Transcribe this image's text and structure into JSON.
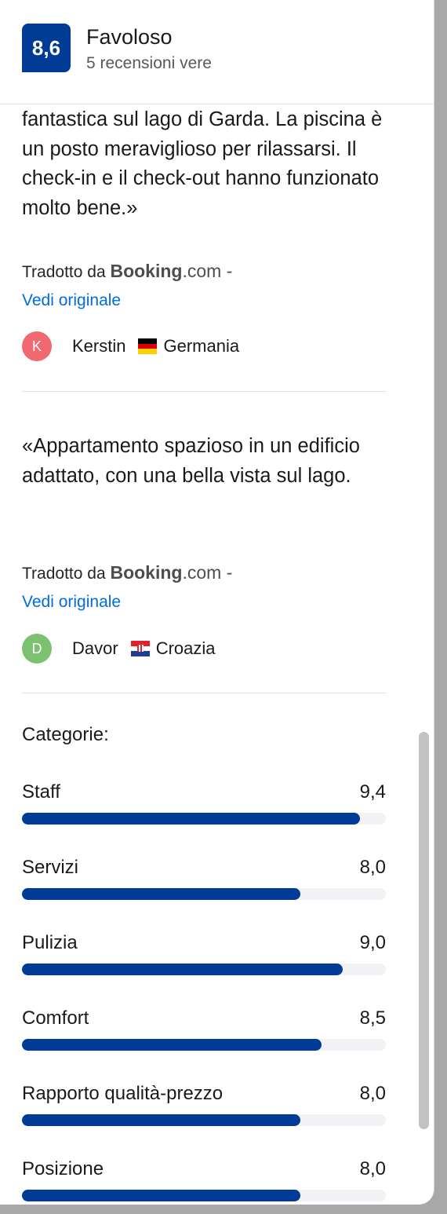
{
  "header": {
    "score": "8,6",
    "rating_label": "Favoloso",
    "review_count": "5 recensioni vere"
  },
  "colors": {
    "brand_blue": "#003b95",
    "link_blue": "#006ce4"
  },
  "reviews": [
    {
      "text": "fantastica sul lago di Garda. La piscina è un posto meraviglioso per rilassarsi. Il check-in e il check-out hanno funzionato molto bene.»",
      "translated_prefix": "Tradotto da",
      "brand_bold": "Booking",
      "brand_suffix": ".com -",
      "view_original": "Vedi originale",
      "reviewer": {
        "initial": "K",
        "name": "Kerstin",
        "country": "Germania",
        "avatar_color": "#f06970",
        "flag": "germany-flag-icon"
      }
    },
    {
      "text": "«Appartamento spazioso in un edificio adattato, con una bella vista sul lago.",
      "translated_prefix": "Tradotto da",
      "brand_bold": "Booking",
      "brand_suffix": ".com -",
      "view_original": "Vedi originale",
      "reviewer": {
        "initial": "D",
        "name": "Davor",
        "country": "Croazia",
        "avatar_color": "#7cc16f",
        "flag": "croatia-flag-icon"
      }
    }
  ],
  "categories": {
    "title": "Categorie:",
    "max_score": 10,
    "items": [
      {
        "label": "Staff",
        "score": "9,4",
        "value": 9.4
      },
      {
        "label": "Servizi",
        "score": "8,0",
        "value": 8.0
      },
      {
        "label": "Pulizia",
        "score": "9,0",
        "value": 9.0
      },
      {
        "label": "Comfort",
        "score": "8,5",
        "value": 8.5
      },
      {
        "label": "Rapporto qualità-prezzo",
        "score": "8,0",
        "value": 8.0
      },
      {
        "label": "Posizione",
        "score": "8,0",
        "value": 8.0
      }
    ]
  }
}
